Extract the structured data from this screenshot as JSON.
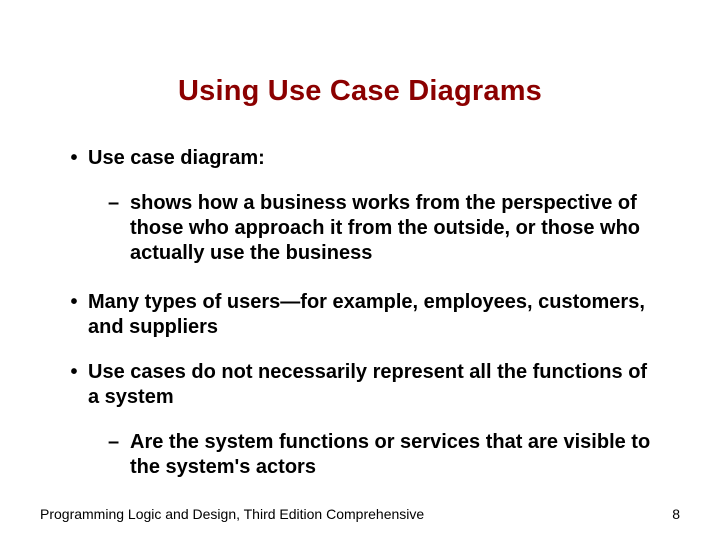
{
  "title": "Using Use Case Diagrams",
  "b1": "Use case diagram:",
  "b1a": "shows how a business works from the perspective of those who approach it from the outside, or those who actually use the business",
  "b2": "Many types of users—for example, employees, customers, and suppliers",
  "b3": "Use cases do not necessarily represent all the functions of a system",
  "b3a": "Are the system functions or services that are visible to the system's actors",
  "footer_text": "Programming Logic and Design, Third Edition Comprehensive",
  "page_num": "8"
}
